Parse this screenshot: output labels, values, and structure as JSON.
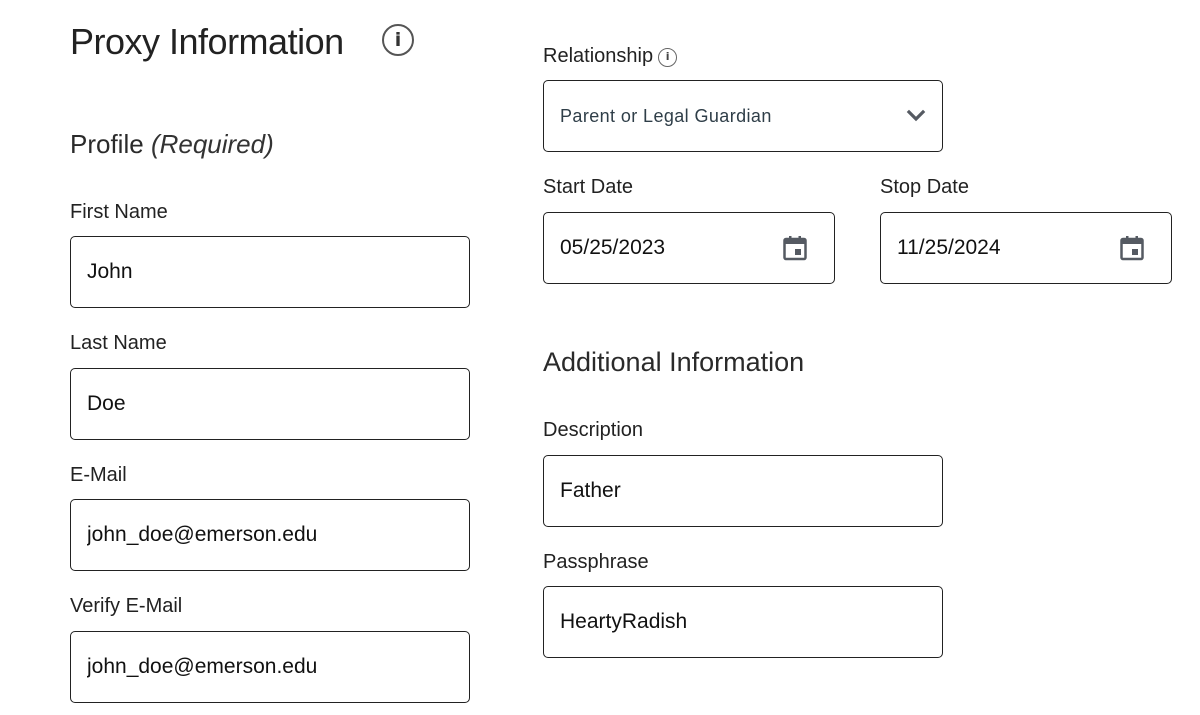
{
  "header": {
    "title": "Proxy Information",
    "info_icon": "info-circle-icon"
  },
  "profile": {
    "title": "Profile",
    "required_note": "(Required)",
    "fields": {
      "first_name": {
        "label": "First Name",
        "value": "John"
      },
      "last_name": {
        "label": "Last Name",
        "value": "Doe"
      },
      "email": {
        "label": "E-Mail",
        "value": "john_doe@emerson.edu"
      },
      "verify_email": {
        "label": "Verify E-Mail",
        "value": "john_doe@emerson.edu"
      }
    }
  },
  "relationship": {
    "label": "Relationship",
    "info_icon": "info-circle-icon",
    "selected": "Parent or Legal Guardian",
    "dropdown_icon": "chevron-down-icon"
  },
  "dates": {
    "start": {
      "label": "Start Date",
      "value": "05/25/2023",
      "icon": "calendar-icon"
    },
    "stop": {
      "label": "Stop Date",
      "value": "11/25/2024",
      "icon": "calendar-icon"
    }
  },
  "additional": {
    "title": "Additional Information",
    "fields": {
      "description": {
        "label": "Description",
        "value": "Father"
      },
      "passphrase": {
        "label": "Passphrase",
        "value": "HeartyRadish"
      }
    }
  },
  "colors": {
    "text": "#222222",
    "border": "#222222",
    "icon": "#555a62",
    "select_text": "#2f3e48"
  }
}
